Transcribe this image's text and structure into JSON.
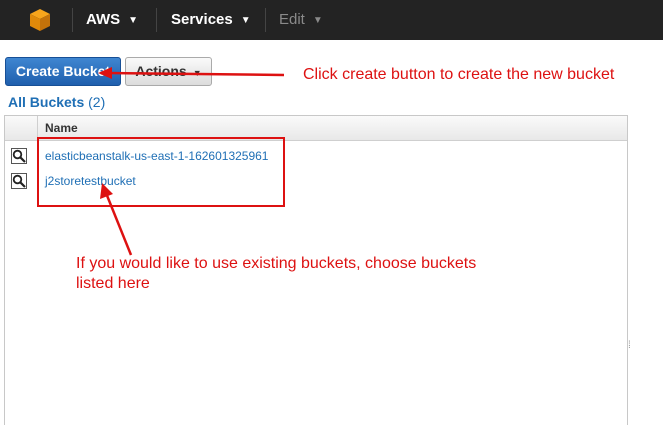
{
  "topbar": {
    "brand": "AWS",
    "services": "Services",
    "edit": "Edit"
  },
  "toolbar": {
    "create_label": "Create Bucket",
    "actions_label": "Actions"
  },
  "buckets_header": {
    "label": "All Buckets",
    "count": "(2)"
  },
  "table": {
    "column_name": "Name",
    "rows": [
      {
        "name": "elasticbeanstalk-us-east-1-162601325961",
        "icon": "magnifier-icon"
      },
      {
        "name": "j2storetestbucket",
        "icon": "magnifier-icon"
      }
    ]
  },
  "annotations": {
    "create_hint": "Click create button to create the new bucket",
    "existing_hint": "If you would like to use existing buckets, choose buckets listed here"
  },
  "colors": {
    "topbar": "#232323",
    "primary_button": "#2a6fc0",
    "link": "#1f6fb5",
    "annotation": "#dd1111"
  }
}
